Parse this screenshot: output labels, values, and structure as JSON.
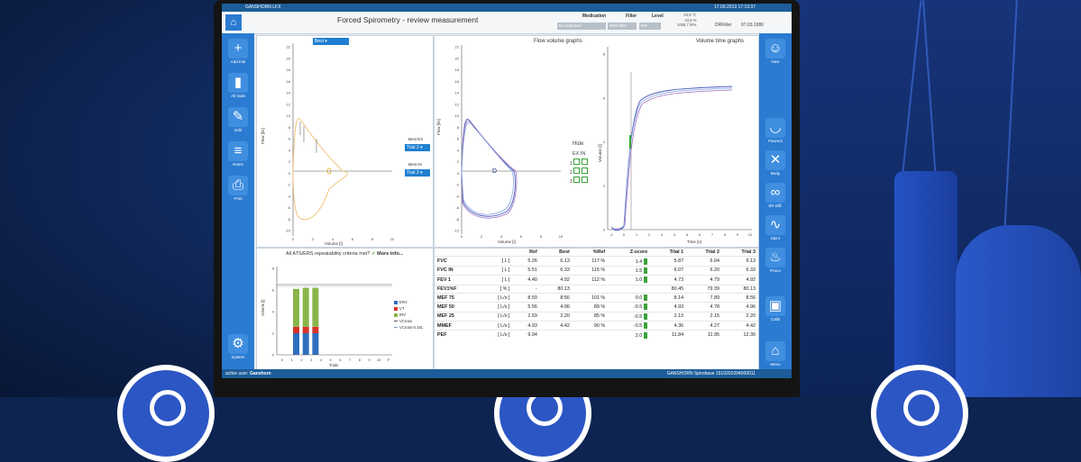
{
  "topbar": {
    "app_name": "GANSHORN LFX",
    "datetime": "17.09.2013 17:13:37"
  },
  "header": {
    "title": "Forced Spirometry - review measurement",
    "medication_label": "Medication",
    "medication_value": "No selection",
    "filter_label": "Filter",
    "filter_value": "With filter",
    "level_label": "Level",
    "level_value": "Pre",
    "env_temp": "23,9 °C",
    "env_humidity": "43,9 %",
    "env_pressure": "1008,7 hPa",
    "filter_name": "DRFilter",
    "date": "07.03.1986"
  },
  "left_sidebar": [
    {
      "label": "Add trial",
      "icon": "plus-icon",
      "glyph": "+"
    },
    {
      "label": "All trials",
      "icon": "trials-icon",
      "glyph": "▮"
    },
    {
      "label": "Edit",
      "icon": "pencil-icon",
      "glyph": "✎"
    },
    {
      "label": "Notes",
      "icon": "notes-icon",
      "glyph": "≡"
    },
    {
      "label": "Print",
      "icon": "printer-icon",
      "glyph": "⎙"
    },
    {
      "label": "System",
      "icon": "gear-icon",
      "glyph": "⚙"
    }
  ],
  "right_sidebar": [
    {
      "label": "New",
      "icon": "person-icon",
      "glyph": "☺"
    },
    {
      "label": "FlowVol",
      "icon": "lung-icon",
      "glyph": "◡"
    },
    {
      "label": "Body",
      "icon": "body-icon",
      "glyph": "✕"
    },
    {
      "label": "SR Diff.",
      "icon": "bike-icon",
      "glyph": "∞"
    },
    {
      "label": "Spiro",
      "icon": "spiro-icon",
      "glyph": "∿"
    },
    {
      "label": "Provo",
      "icon": "provo-icon",
      "glyph": "♨"
    },
    {
      "label": "Calib",
      "icon": "calib-icon",
      "glyph": "▣"
    },
    {
      "label": "Menu",
      "icon": "home-icon",
      "glyph": "⌂"
    }
  ],
  "left_graph": {
    "select_value": "Best",
    "best_ex_label": "Best EX",
    "best_ex_value": "Trial 3",
    "best_in_label": "Best IN",
    "best_in_value": "Trial 3",
    "y_ticks": [
      "22",
      "20",
      "18",
      "16",
      "14",
      "12",
      "10",
      "8",
      "6",
      "4",
      "2",
      "0",
      "-2",
      "-4",
      "-6",
      "-8",
      "-10"
    ],
    "x_ticks": [
      "0",
      "2",
      "4",
      "6",
      "8",
      "10"
    ],
    "ylabel": "Flow [l/s]",
    "xlabel": "Volume [l]"
  },
  "flow_volume": {
    "title": "Flow volume graphs",
    "hide_label": "Hide",
    "ex_in_label": "EX IN",
    "rows": [
      "1",
      "2",
      "3"
    ],
    "y_ticks": [
      "22",
      "20",
      "18",
      "16",
      "14",
      "12",
      "10",
      "8",
      "6",
      "4",
      "2",
      "0",
      "-2",
      "-4",
      "-6",
      "-8",
      "-10"
    ],
    "x_ticks": [
      "0",
      "2",
      "4",
      "6",
      "8",
      "10"
    ],
    "ylabel": "Flow [l/s]",
    "xlabel": "Volume [l]"
  },
  "volume_time": {
    "title": "Volume time graphs",
    "y_ticks": [
      "8",
      "6",
      "4",
      "2",
      "0"
    ],
    "x_ticks": [
      "-1",
      "0",
      "1",
      "2",
      "3",
      "4",
      "5",
      "6",
      "7",
      "8",
      "9",
      "10"
    ],
    "ylabel": "Volume [l]",
    "xlabel": "Time [s]"
  },
  "repeatability": {
    "prompt": "All ATS/ERS repeatability criteria met?",
    "check": "✓",
    "link": "More info...",
    "y_ticks": [
      "8",
      "6",
      "4",
      "2",
      "0"
    ],
    "x_ticks": [
      "0",
      "1",
      "2",
      "3",
      "4",
      "5",
      "6",
      "7",
      "8",
      "9",
      "10",
      "P"
    ],
    "ylabel": "Volume [l]",
    "xlabel": "Trials",
    "legend": [
      {
        "label": "ERV",
        "color": "#2f6fc0"
      },
      {
        "label": "VT",
        "color": "#d8322a"
      },
      {
        "label": "IRV",
        "color": "#8ab54a"
      },
      {
        "label": "VCmax",
        "color": "#555555"
      },
      {
        "label": "VCmax-0.15L",
        "color": "#7f9fbf"
      }
    ],
    "chart_data": {
      "type": "bar",
      "categories": [
        "1",
        "2",
        "3"
      ],
      "series": [
        {
          "name": "ERV",
          "values": [
            2.0,
            2.0,
            2.0
          ]
        },
        {
          "name": "VT",
          "values": [
            0.6,
            0.6,
            0.6
          ]
        },
        {
          "name": "IRV",
          "values": [
            3.5,
            3.6,
            3.6
          ]
        }
      ],
      "ylim": [
        0,
        8
      ]
    }
  },
  "results": {
    "headers": [
      "",
      "",
      "Ref",
      "Best",
      "%Ref",
      "Z-score",
      "Trial 1",
      "Trial 2",
      "Trial 3"
    ],
    "rows": [
      {
        "name": "FVC",
        "unit": "[ L ]",
        "ref": "5.26",
        "best": "6.13",
        "pref": "117 %",
        "z": "1.4",
        "t1": "5.87",
        "t2": "6.04",
        "t3": "6.13"
      },
      {
        "name": "FVC IN",
        "unit": "[ L ]",
        "ref": "5.51",
        "best": "6.33",
        "pref": "115 %",
        "z": "1.5",
        "t1": "6.07",
        "t2": "6.20",
        "t3": "6.33"
      },
      {
        "name": "FEV 1",
        "unit": "[ L ]",
        "ref": "4.40",
        "best": "4.92",
        "pref": "112 %",
        "z": "1.0",
        "t1": "4.73",
        "t2": "4.79",
        "t3": "4.92"
      },
      {
        "name": "FEV1%F",
        "unit": "[ % ]",
        "ref": "-",
        "best": "80.13",
        "pref": "",
        "z": "",
        "t1": "80.45",
        "t2": "79.39",
        "t3": "80.13"
      },
      {
        "name": "MEF 75",
        "unit": "[ L/s ]",
        "ref": "8.50",
        "best": "8.56",
        "pref": "101 %",
        "z": "0.0",
        "t1": "8.14",
        "t2": "7.89",
        "t3": "8.56"
      },
      {
        "name": "MEF 50",
        "unit": "[ L/s ]",
        "ref": "5.56",
        "best": "4.96",
        "pref": "89 %",
        "z": "-0.5",
        "t1": "4.93",
        "t2": "4.78",
        "t3": "4.96"
      },
      {
        "name": "MEF 25",
        "unit": "[ L/s ]",
        "ref": "2.59",
        "best": "2.20",
        "pref": "85 %",
        "z": "-0.5",
        "t1": "2.13",
        "t2": "2.15",
        "t3": "2.20"
      },
      {
        "name": "MMEF",
        "unit": "[ L/s ]",
        "ref": "4.93",
        "best": "4.42",
        "pref": "90 %",
        "z": "-0.5",
        "t1": "4.36",
        "t2": "4.27",
        "t3": "4.42"
      },
      {
        "name": "PEF",
        "unit": "[ L/s ]",
        "ref": "9.94",
        "best": "",
        "pref": "",
        "z": "2.0",
        "t1": "11.84",
        "t2": "11.95",
        "t3": "12.30"
      }
    ]
  },
  "status": {
    "active_user_label": "active user:",
    "active_user": "Ganshorn",
    "device": "GANSHORN Spirobase 1510201094000011"
  },
  "colors": {
    "accent": "#2b7bd2",
    "statusbar": "#1c5d99",
    "green": "#3aa23a",
    "curve_orange": "#f0c070",
    "curve_blue": "#4a5ac0",
    "curve_purple": "#a070c0"
  }
}
